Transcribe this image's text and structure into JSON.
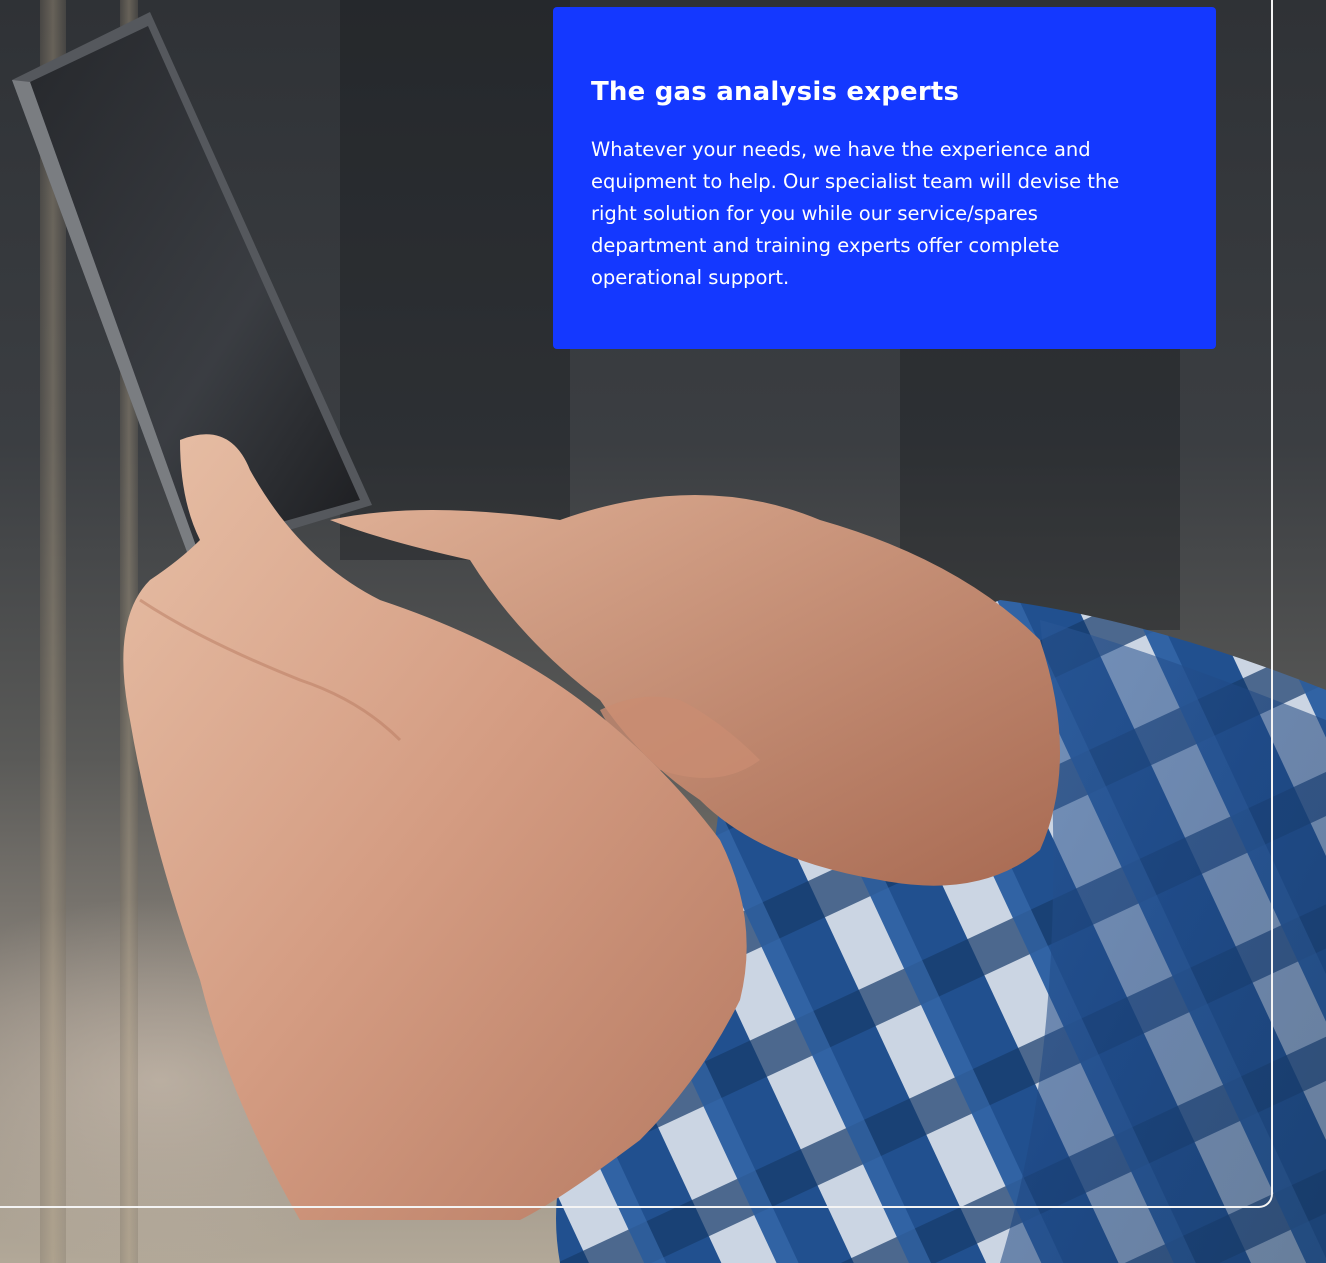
{
  "hero": {
    "image_alt": "Hands holding a tablet"
  },
  "card": {
    "title": "The gas analysis experts",
    "body": "Whatever your needs, we have the experience and equipment to help. Our specialist team will devise the right solution for you while our service/spares department and training experts offer complete operational support.",
    "background_color": "#1438ff",
    "text_color": "#ffffff"
  },
  "frame": {
    "line_color": "#f4f4f4"
  }
}
